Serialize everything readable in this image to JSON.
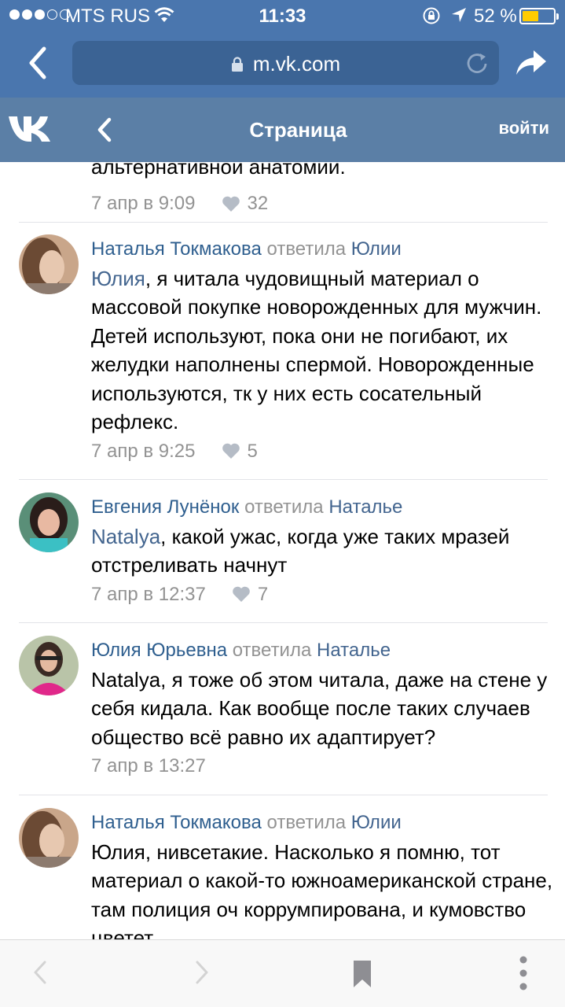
{
  "status_bar": {
    "carrier": "MTS RUS",
    "time": "11:33",
    "battery_percent": "52 %",
    "battery_level": 0.52
  },
  "browser": {
    "url": "m.vk.com"
  },
  "vk_header": {
    "title": "Страница",
    "login": "войти"
  },
  "top_partial": {
    "text": "альтернативной анатомии.",
    "date": "7 апр в 9:09",
    "likes": "32"
  },
  "comments": [
    {
      "author": "Наталья Токмакова",
      "action": "ответила",
      "reply_to": "Юлии",
      "mention": "Юлия",
      "text": ", я читала чудовищный материал о массовой покупке новорожденных для мужчин. Детей используют, пока они не погибают, их желудки наполнены спермой. Новорожденные используются, тк у них есть сосательный рефлекс.",
      "date": "7 апр в 9:25",
      "likes": "5"
    },
    {
      "author": "Евгения Лунёнок",
      "action": "ответила",
      "reply_to": "Наталье",
      "mention": "Natalya",
      "text": ", какой ужас, когда уже таких мразей отстреливать начнут",
      "date": "7 апр в 12:37",
      "likes": "7"
    },
    {
      "author": "Юлия Юрьевна",
      "action": "ответила",
      "reply_to": "Наталье",
      "mention": "",
      "text": "Natalya, я тоже об этом читала, даже на стене у себя кидала. Как вообще после таких случаев общество всё равно их адаптирует?",
      "date": "7 апр в 13:27",
      "likes": ""
    },
    {
      "author": "Наталья Токмакова",
      "action": "ответила",
      "reply_to": "Юлии",
      "mention": "",
      "text": "Юлия, нивсетакие. Насколько я помню, тот материал о какой-то южноамериканской стране, там полиция оч коррумпирована, и кумовство цветет",
      "date": "",
      "likes": ""
    }
  ],
  "icons": [
    "signal-dots-icon",
    "wifi-icon",
    "rotation-lock-icon",
    "location-arrow-icon",
    "battery-icon",
    "padlock-icon",
    "reload-icon",
    "share-icon",
    "vk-logo",
    "back-chevron-icon",
    "heart-icon",
    "bookmark-icon",
    "more-dots-icon"
  ],
  "colors": {
    "safari_bar": "#4a76ae",
    "vk_header": "#5b7fa6",
    "link": "#2f5f8f",
    "meta": "#939393",
    "battery": "#ffcc00"
  }
}
